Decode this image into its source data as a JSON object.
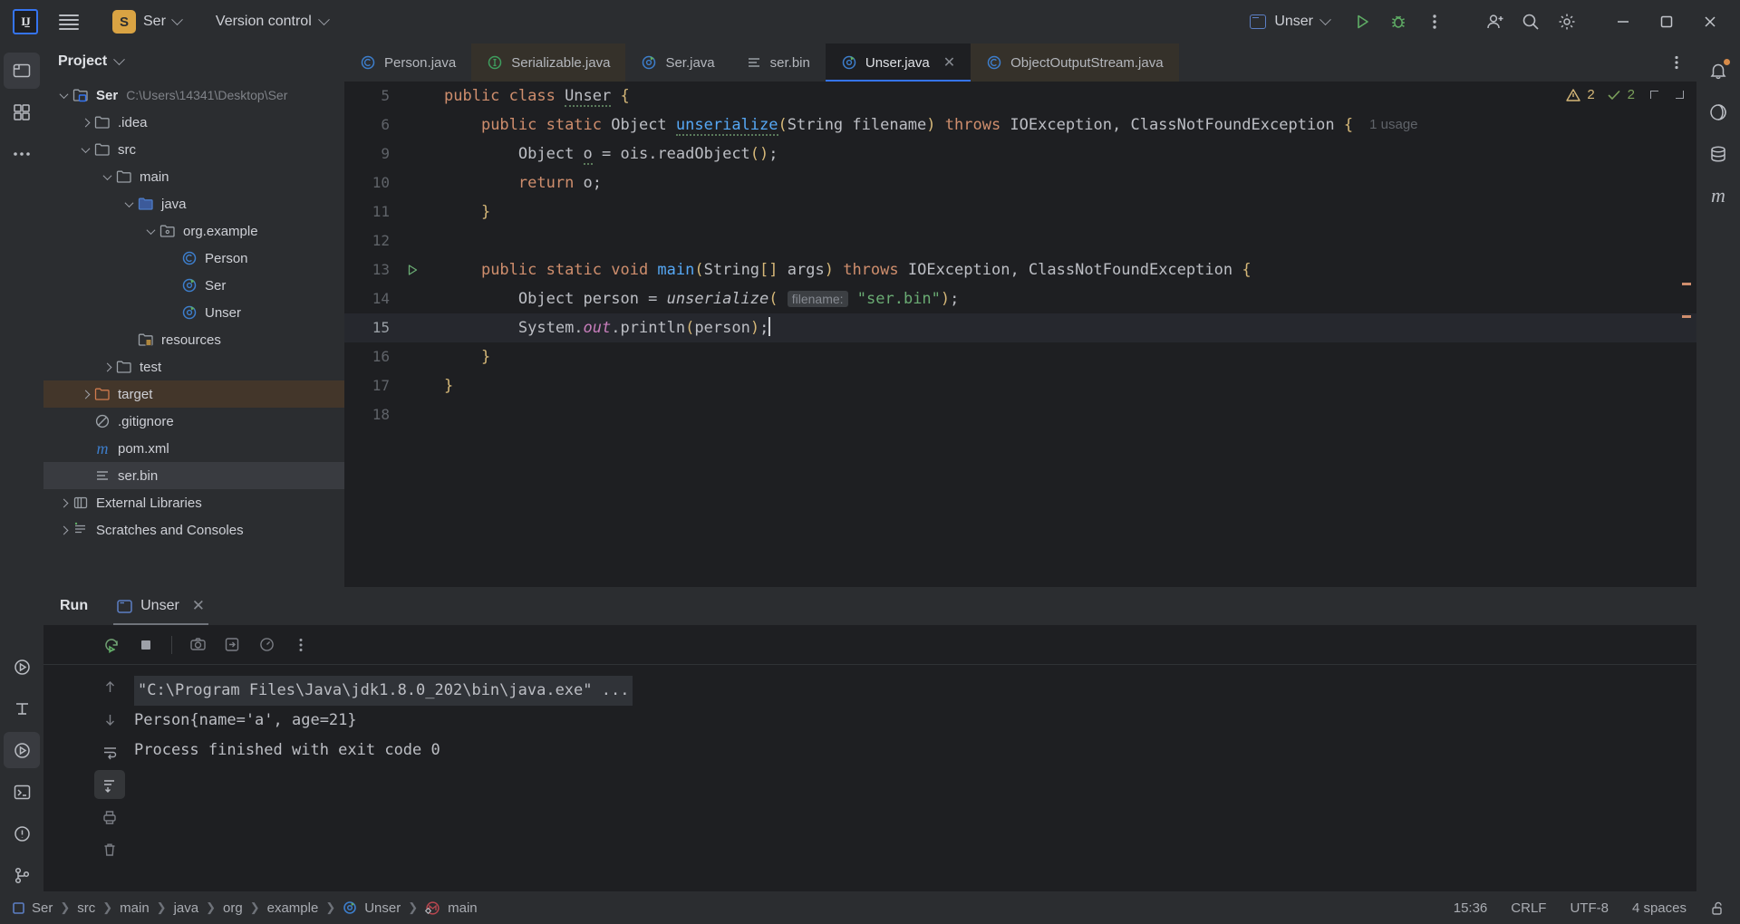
{
  "titlebar": {
    "logo": "IJ",
    "menu_icon": "hamburger-icon",
    "project_badge": "S",
    "project_name": "Ser",
    "vcs_label": "Version control",
    "run_config": "Unser",
    "icons": [
      "run-icon",
      "debug-icon",
      "more-actions-icon",
      "account-icon",
      "search-icon",
      "settings-icon",
      "minimize-icon",
      "maximize-icon",
      "close-icon"
    ]
  },
  "project_panel": {
    "title": "Project",
    "tree": [
      {
        "label": "Ser",
        "path": "C:\\Users\\14341\\Desktop\\Ser",
        "indent": 0,
        "arrow": "down",
        "icon": "module-folder-icon",
        "bold": true
      },
      {
        "label": ".idea",
        "indent": 1,
        "arrow": "right",
        "icon": "folder-icon"
      },
      {
        "label": "src",
        "indent": 1,
        "arrow": "down",
        "icon": "folder-icon"
      },
      {
        "label": "main",
        "indent": 2,
        "arrow": "down",
        "icon": "folder-icon"
      },
      {
        "label": "java",
        "indent": 3,
        "arrow": "down",
        "icon": "source-folder-icon"
      },
      {
        "label": "org.example",
        "indent": 4,
        "arrow": "down",
        "icon": "package-folder-icon"
      },
      {
        "label": "Person",
        "indent": 5,
        "arrow": "none",
        "icon": "java-class-icon"
      },
      {
        "label": "Ser",
        "indent": 5,
        "arrow": "none",
        "icon": "java-runnable-class-icon"
      },
      {
        "label": "Unser",
        "indent": 5,
        "arrow": "none",
        "icon": "java-runnable-class-icon"
      },
      {
        "label": "resources",
        "indent": 3,
        "arrow": "none",
        "icon": "resources-folder-icon"
      },
      {
        "label": "test",
        "indent": 2,
        "arrow": "right",
        "icon": "folder-icon"
      },
      {
        "label": "target",
        "indent": 1,
        "arrow": "right",
        "icon": "excluded-folder-icon",
        "state": "target-highlight"
      },
      {
        "label": ".gitignore",
        "indent": 1,
        "arrow": "none",
        "icon": "gitignore-icon"
      },
      {
        "label": "pom.xml",
        "indent": 1,
        "arrow": "none",
        "icon": "maven-icon"
      },
      {
        "label": "ser.bin",
        "indent": 1,
        "arrow": "none",
        "icon": "binary-file-icon",
        "state": "selected"
      },
      {
        "label": "External Libraries",
        "indent": 0,
        "arrow": "right",
        "icon": "libraries-icon"
      },
      {
        "label": "Scratches and Consoles",
        "indent": 0,
        "arrow": "right",
        "icon": "scratches-icon"
      }
    ]
  },
  "editor": {
    "tabs": [
      {
        "label": "Person.java",
        "icon": "java-class-icon",
        "state": "normal"
      },
      {
        "label": "Serializable.java",
        "icon": "java-interface-icon",
        "state": "readonly"
      },
      {
        "label": "Ser.java",
        "icon": "java-runnable-class-icon",
        "state": "normal"
      },
      {
        "label": "ser.bin",
        "icon": "binary-file-icon",
        "state": "normal"
      },
      {
        "label": "Unser.java",
        "icon": "java-runnable-class-icon",
        "state": "active",
        "closable": true
      },
      {
        "label": "ObjectOutputStream.java",
        "icon": "java-class-icon",
        "state": "readonly"
      }
    ],
    "inspection": {
      "warnings": "2",
      "oks": "2"
    },
    "usage_hint": "1 usage",
    "hint_chip": "filename:",
    "lines": [
      {
        "no": "5",
        "indent": 1
      },
      {
        "no": "6",
        "indent": 2
      },
      {
        "no": "9",
        "indent": 3
      },
      {
        "no": "10",
        "indent": 3
      },
      {
        "no": "11",
        "indent": 2
      },
      {
        "no": "12",
        "indent": 0
      },
      {
        "no": "13",
        "indent": 2
      },
      {
        "no": "14",
        "indent": 3
      },
      {
        "no": "15",
        "indent": 3
      },
      {
        "no": "16",
        "indent": 2
      },
      {
        "no": "17",
        "indent": 1
      },
      {
        "no": "18",
        "indent": 0
      }
    ],
    "source_text": [
      "public class Unser {",
      "public static Object unserialize(String filename) throws IOException, ClassNotFoundException {",
      "Object o = ois.readObject();",
      "return o;",
      "}",
      "",
      "public static void main(String[] args) throws IOException, ClassNotFoundException {",
      "Object person = unserialize( filename: \"ser.bin\");",
      "System.out.println(person);",
      "}",
      "}",
      ""
    ]
  },
  "run_panel": {
    "title": "Run",
    "tab_label": "Unser",
    "tab_icon": "run-config-icon",
    "toolbar_icons": [
      "rerun-icon",
      "stop-icon",
      "screenshot-icon",
      "export-icon",
      "profiler-icon",
      "more-icon"
    ],
    "side_icons": [
      "scroll-up-icon",
      "scroll-down-icon",
      "soft-wrap-icon",
      "scroll-to-end-icon",
      "print-icon",
      "clear-all-icon"
    ],
    "console": [
      {
        "text": "\"C:\\Program Files\\Java\\jdk1.8.0_202\\bin\\java.exe\" ...",
        "style": "command"
      },
      {
        "text": "Person{name='a', age=21}",
        "style": "output"
      },
      {
        "text": "",
        "style": "output"
      },
      {
        "text": "Process finished with exit code 0",
        "style": "output"
      }
    ]
  },
  "status_bar": {
    "breadcrumb": [
      "Ser",
      "src",
      "main",
      "java",
      "org",
      "example",
      "Unser",
      "main"
    ],
    "time": "15:36",
    "line_separator": "CRLF",
    "encoding": "UTF-8",
    "indent": "4 spaces",
    "lock_icon": "unlocked-icon"
  },
  "colors": {
    "accent": "#3574f0",
    "bg": "#1e1f22",
    "panel": "#2b2d30",
    "string": "#6aab73",
    "keyword": "#cf8e6d",
    "method": "#56a8f5",
    "brace": "#d5b778",
    "target_highlight": "#43362a"
  }
}
